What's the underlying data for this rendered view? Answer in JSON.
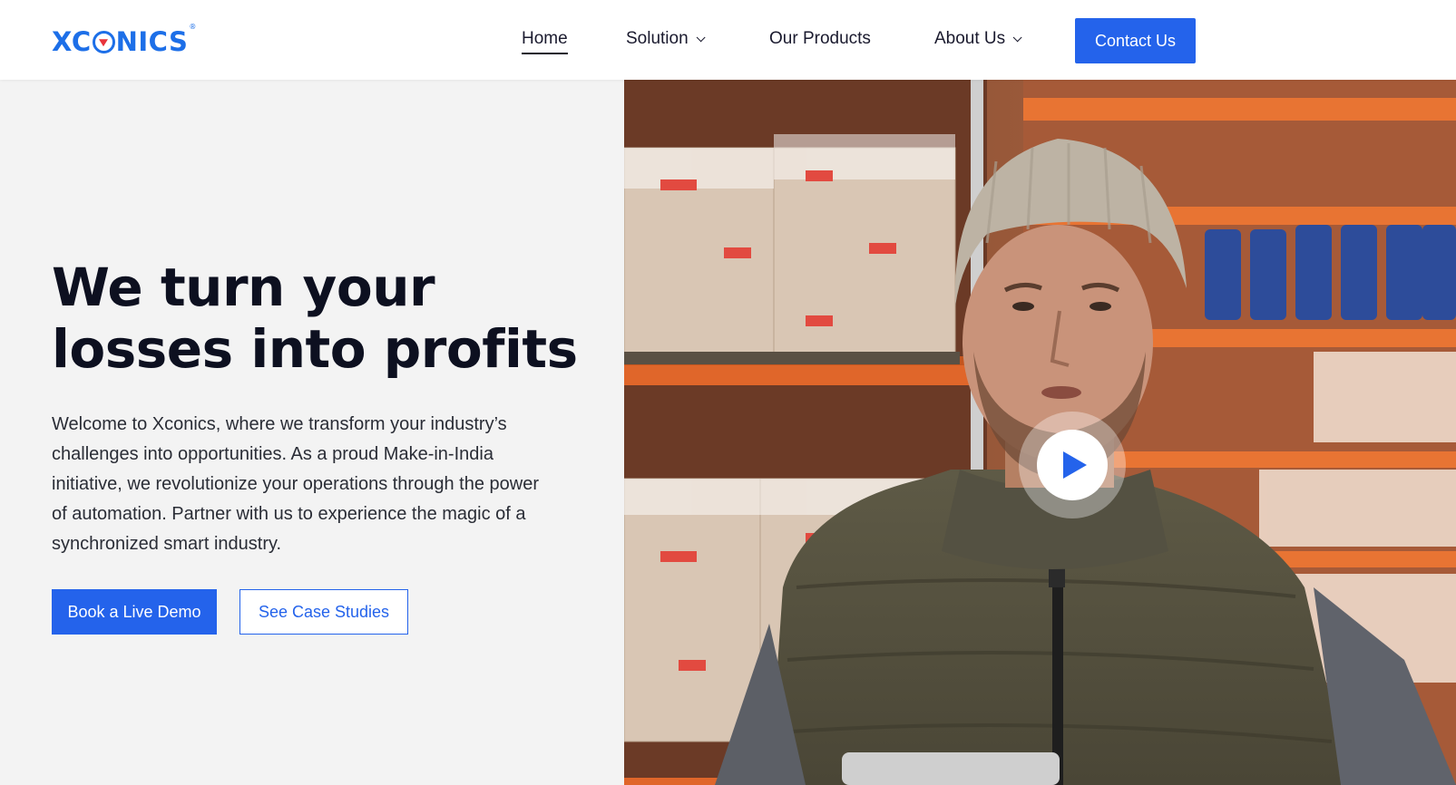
{
  "brand": {
    "name_part1": "XC",
    "name_part2": "NICS",
    "registered": "®",
    "color": "#1d6fe8",
    "accent": "#e8333b"
  },
  "nav": {
    "items": [
      {
        "label": "Home",
        "active": true,
        "has_dropdown": false
      },
      {
        "label": "Solution",
        "active": false,
        "has_dropdown": true
      },
      {
        "label": "Our Products",
        "active": false,
        "has_dropdown": false
      },
      {
        "label": "About Us",
        "active": false,
        "has_dropdown": true
      }
    ],
    "cta_label": "Contact Us"
  },
  "hero": {
    "headline": "We turn your losses into profits",
    "intro": "Welcome to Xconics, where we transform your industry’s challenges into opportunities. As a proud Make-in-India initiative, we revolutionize your operations through the power of automation. Partner with us to experience the magic of a synchronized smart industry.",
    "primary_button": "Book a Live Demo",
    "secondary_button": "See Case Studies",
    "media": {
      "icon": "play-icon"
    }
  },
  "colors": {
    "primary": "#2463eb",
    "text_dark": "#0d1020",
    "hero_bg": "#f3f3f3"
  }
}
